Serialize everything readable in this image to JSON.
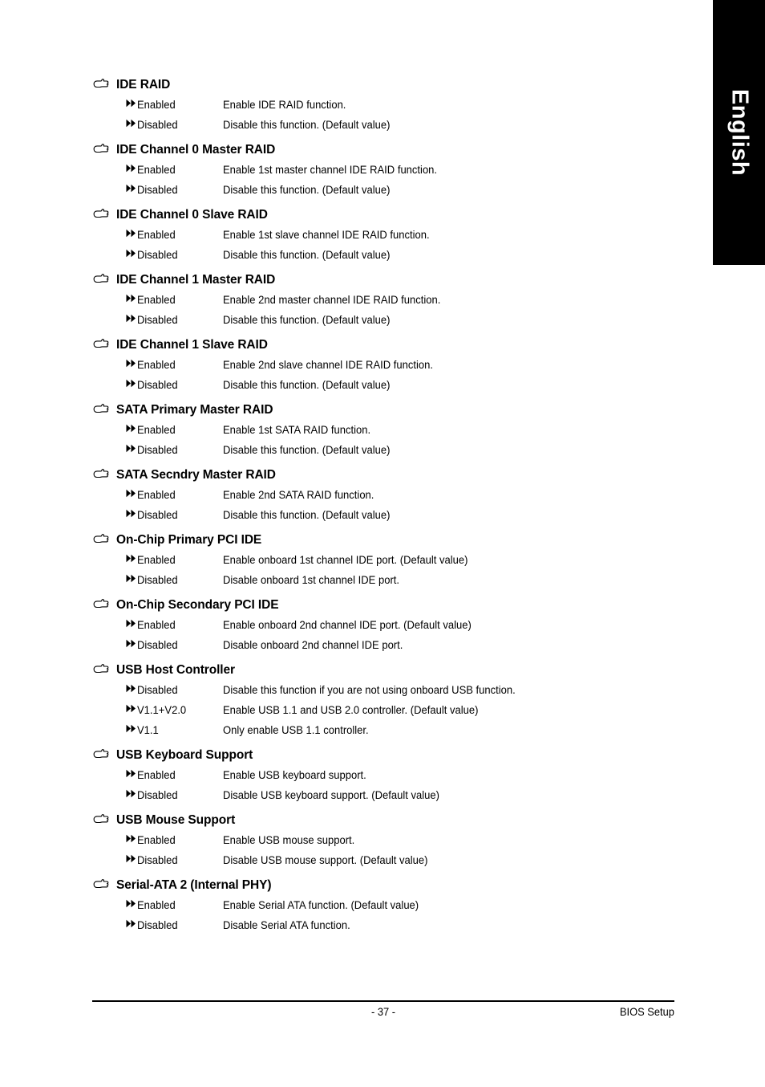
{
  "page": {
    "language_tab": "English",
    "page_number": "- 37 -",
    "footer_right": "BIOS Setup"
  },
  "icons": {
    "heading_bullet": "pointing-hand-icon",
    "option_bullet": "double-right-arrow-icon"
  },
  "sections": [
    {
      "title": "IDE RAID",
      "options": [
        {
          "label": "Enabled",
          "desc": "Enable IDE RAID function."
        },
        {
          "label": "Disabled",
          "desc": "Disable this function. (Default value)"
        }
      ]
    },
    {
      "title": "IDE Channel 0 Master RAID",
      "options": [
        {
          "label": "Enabled",
          "desc": "Enable 1st master channel IDE RAID function."
        },
        {
          "label": "Disabled",
          "desc": "Disable this function. (Default value)"
        }
      ]
    },
    {
      "title": "IDE Channel 0 Slave RAID",
      "options": [
        {
          "label": "Enabled",
          "desc": "Enable 1st slave channel IDE RAID function."
        },
        {
          "label": "Disabled",
          "desc": "Disable this function. (Default value)"
        }
      ]
    },
    {
      "title": "IDE Channel 1 Master RAID",
      "options": [
        {
          "label": "Enabled",
          "desc": "Enable 2nd master channel IDE RAID function."
        },
        {
          "label": "Disabled",
          "desc": "Disable this function. (Default value)"
        }
      ]
    },
    {
      "title": "IDE Channel 1 Slave RAID",
      "options": [
        {
          "label": "Enabled",
          "desc": "Enable 2nd slave channel IDE RAID function."
        },
        {
          "label": "Disabled",
          "desc": "Disable this function. (Default value)"
        }
      ]
    },
    {
      "title": "SATA Primary Master RAID",
      "options": [
        {
          "label": "Enabled",
          "desc": "Enable 1st SATA RAID function."
        },
        {
          "label": "Disabled",
          "desc": "Disable this function. (Default value)"
        }
      ]
    },
    {
      "title": "SATA Secndry Master RAID",
      "options": [
        {
          "label": "Enabled",
          "desc": "Enable 2nd SATA RAID function."
        },
        {
          "label": "Disabled",
          "desc": "Disable this function. (Default value)"
        }
      ]
    },
    {
      "title": "On-Chip Primary PCI IDE",
      "options": [
        {
          "label": "Enabled",
          "desc": "Enable onboard 1st channel IDE port. (Default value)"
        },
        {
          "label": "Disabled",
          "desc": "Disable onboard 1st channel IDE port."
        }
      ]
    },
    {
      "title": "On-Chip Secondary PCI IDE",
      "options": [
        {
          "label": "Enabled",
          "desc": "Enable onboard 2nd channel IDE port. (Default value)"
        },
        {
          "label": "Disabled",
          "desc": "Disable onboard 2nd  channel IDE port."
        }
      ]
    },
    {
      "title": "USB Host Controller",
      "options": [
        {
          "label": "Disabled",
          "desc": "Disable this function if you are not using onboard USB function."
        },
        {
          "label": "V1.1+V2.0",
          "desc": "Enable USB 1.1 and USB 2.0 controller. (Default value)"
        },
        {
          "label": "V1.1",
          "desc": "Only enable USB 1.1 controller."
        }
      ]
    },
    {
      "title": "USB Keyboard Support",
      "options": [
        {
          "label": "Enabled",
          "desc": "Enable USB keyboard support."
        },
        {
          "label": "Disabled",
          "desc": "Disable USB keyboard support. (Default value)"
        }
      ]
    },
    {
      "title": "USB Mouse Support",
      "options": [
        {
          "label": "Enabled",
          "desc": "Enable USB mouse support."
        },
        {
          "label": "Disabled",
          "desc": "Disable USB mouse support. (Default value)"
        }
      ]
    },
    {
      "title": "Serial-ATA 2 (Internal PHY)",
      "options": [
        {
          "label": "Enabled",
          "desc": "Enable Serial ATA function. (Default value)"
        },
        {
          "label": "Disabled",
          "desc": "Disable Serial ATA function."
        }
      ]
    }
  ]
}
